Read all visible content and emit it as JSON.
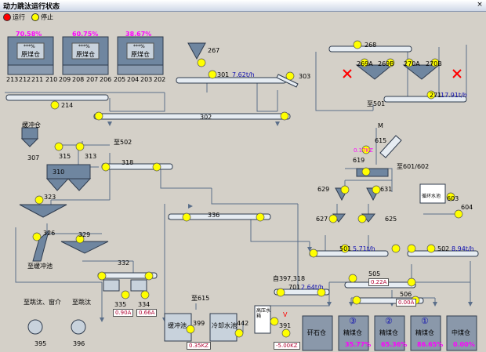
{
  "window": {
    "title": "动力跳汰运行状态",
    "close_glyph": "×"
  },
  "legend": {
    "run_label": "运行",
    "stop_label": "停止",
    "run_color": "#ff0000",
    "stop_color": "#ffff00"
  },
  "colors": {
    "equipment": "#6f86a0",
    "equipment_light": "#c8d2dc",
    "pipe": "#5b6f8a",
    "motor": "#ffff00",
    "background": "#d4d0c8"
  },
  "bins": [
    {
      "pct": "70.58%",
      "stars": "***%",
      "name": "原煤仓"
    },
    {
      "pct": "60.75%",
      "stars": "***%",
      "name": "原煤仓"
    },
    {
      "pct": "38.67%",
      "stars": "***%",
      "name": "原煤仓"
    }
  ],
  "feeders": [
    "213",
    "212",
    "211",
    "210",
    "209",
    "208",
    "207",
    "206",
    "205",
    "204",
    "203",
    "202"
  ],
  "labels": {
    "214": "214",
    "267": "267",
    "301": "301",
    "303": "303",
    "302": "302",
    "268": "268",
    "269a": "269A",
    "269b": "269B",
    "270a": "270A",
    "270b": "270B",
    "271": "271",
    "to501": "至501",
    "to502": "至502",
    "to601": "至601/602",
    "307": "307",
    "315": "315",
    "313": "313",
    "310": "310",
    "318": "318",
    "323": "323",
    "336": "336",
    "326": "326",
    "329": "329",
    "332": "332",
    "335": "335",
    "334": "334",
    "615": "615",
    "619": "619",
    "629": "629",
    "631": "631",
    "627": "627",
    "625": "625",
    "603": "603",
    "604": "604",
    "501": "501",
    "502": "502",
    "505": "505",
    "506": "506",
    "701": "701",
    "391": "391",
    "399": "399",
    "442": "442",
    "395": "395",
    "396": "396",
    "m_mark": "M",
    "v_mark": "V",
    "from397": "自397,318",
    "to615": "至615",
    "to_buffer": "至缓冲池",
    "to_jig1": "至跳汰、窗介",
    "to_jig2": "至跳汰",
    "coal_bin_small": "缓冲仓",
    "recycle_pool": "循环水池",
    "buffer_pool": "缓冲池",
    "cooling_pool": "冷却水池",
    "hydro_pool": "高压水箱",
    "gangue_bin": "矸石仓",
    "clean_bin": "精煤仓",
    "mid_bin": "中煤仓",
    "n3": "③",
    "n2": "②",
    "n1": "①"
  },
  "readings": {
    "r301": "7.62t/h",
    "r271": "17.91t/h",
    "r619": "0.17KZ",
    "r501": "5.71t/h",
    "r502": "8.94t/h",
    "r505": "0.22A",
    "r506": "0.00A",
    "r701": "2.64t/h",
    "r335": "0.90A",
    "r334": "0.66A",
    "r399": "0.35KZ",
    "r391": "-5.00KZ",
    "b3": "35.77%",
    "b2": "65.36%",
    "b1": "86.65%",
    "bmid": "0.00%"
  }
}
